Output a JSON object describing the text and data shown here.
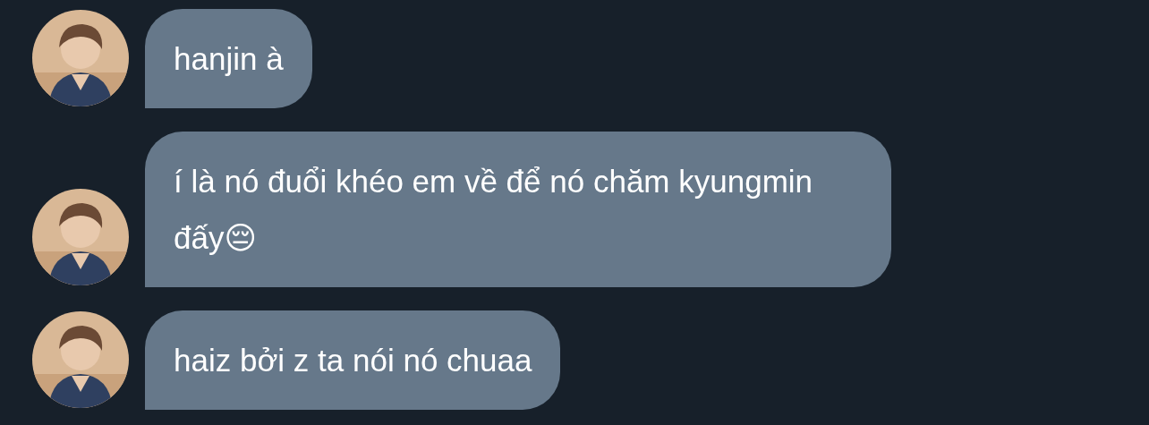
{
  "messages": [
    {
      "text": "hanjin à"
    },
    {
      "text": "í là nó đuổi khéo em về để nó chăm kyungmin đấy😔"
    },
    {
      "text": "haiz bởi z ta nói nó chuaa"
    }
  ]
}
